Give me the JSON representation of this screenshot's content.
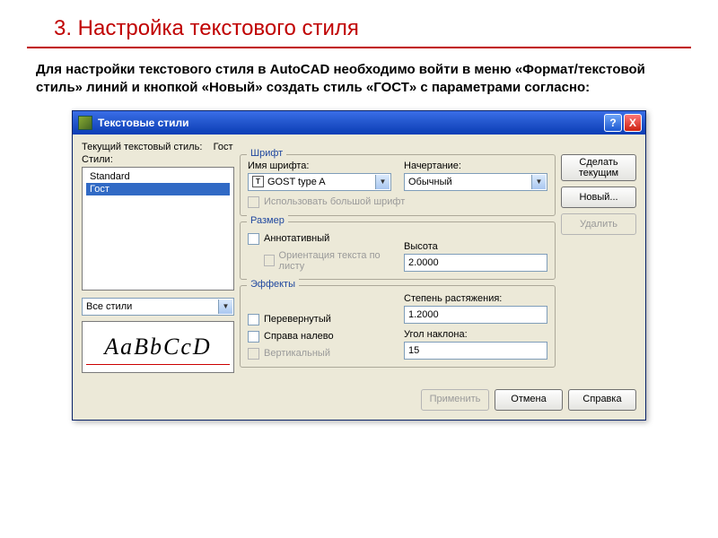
{
  "slide": {
    "title": "3. Настройка текстового стиля",
    "text": "Для настройки текстового стиля в AutoCAD необходимо войти в меню «Формат/текстовой стиль» линий и кнопкой «Новый» создать стиль «ГОСТ» с параметрами согласно:"
  },
  "dialog": {
    "title": "Текстовые стили",
    "help": "?",
    "close": "X",
    "current_label": "Текущий текстовый стиль:",
    "current_value": "Гост",
    "styles_label": "Стили:",
    "styles_list": {
      "items": [
        "Standard",
        "Гост"
      ],
      "selected_index": 1
    },
    "filter": "Все стили",
    "preview_text": "AaBbCcD",
    "font_group": {
      "legend": "Шрифт",
      "name_label": "Имя шрифта:",
      "name_value": "GOST type A",
      "style_label": "Начертание:",
      "style_value": "Обычный",
      "bigfont_label": "Использовать большой шрифт"
    },
    "size_group": {
      "legend": "Размер",
      "annotative_label": "Аннотативный",
      "orient_label": "Ориентация текста по листу",
      "height_label": "Высота",
      "height_value": "2.0000"
    },
    "effects_group": {
      "legend": "Эффекты",
      "upside_label": "Перевернутый",
      "rtl_label": "Справа налево",
      "vertical_label": "Вертикальный",
      "widthfactor_label": "Степень растяжения:",
      "widthfactor_value": "1.2000",
      "oblique_label": "Угол наклона:",
      "oblique_value": "15"
    },
    "buttons": {
      "setcurrent": "Сделать текущим",
      "new": "Новый...",
      "delete": "Удалить",
      "apply": "Применить",
      "cancel": "Отмена",
      "help": "Справка"
    }
  }
}
